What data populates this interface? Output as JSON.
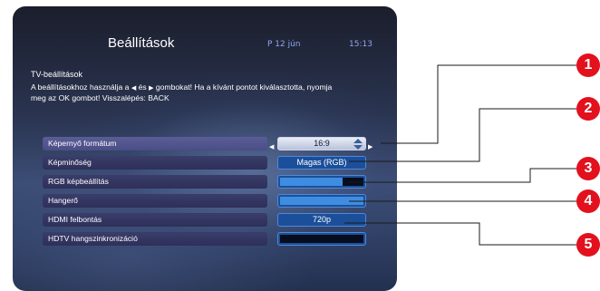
{
  "header": {
    "title": "Beállítások",
    "date": "P 12 jún",
    "time": "15:13"
  },
  "section": {
    "title": "TV-beállítások",
    "instruction_part1": "A beállításokhoz használja a",
    "left_glyph": "◀",
    "and_word": "és",
    "right_glyph": "▶",
    "instruction_part2": "gombokat! Ha a kívánt pontot kiválasztotta, nyomja meg az OK gombot! Visszalépés: BACK"
  },
  "settings": [
    {
      "label": "Képernyő formátum",
      "value": "16:9",
      "selected": true
    },
    {
      "label": "Képminőség",
      "value": "Magas (RGB)"
    },
    {
      "label": "RGB képbeállítás",
      "level": 0.75
    },
    {
      "label": "Hangerő",
      "level": 1.0
    },
    {
      "label": "HDMI felbontás",
      "value": "720p"
    },
    {
      "label": "HDTV hangszinkronizáció",
      "level": 0.0
    }
  ],
  "callouts": [
    "1",
    "2",
    "3",
    "4",
    "5"
  ],
  "colors": {
    "callout": "#e3101d",
    "value_bg": "#1c4f9a",
    "label_bg": "#2e305a",
    "accent_text": "#8fa6ee"
  }
}
